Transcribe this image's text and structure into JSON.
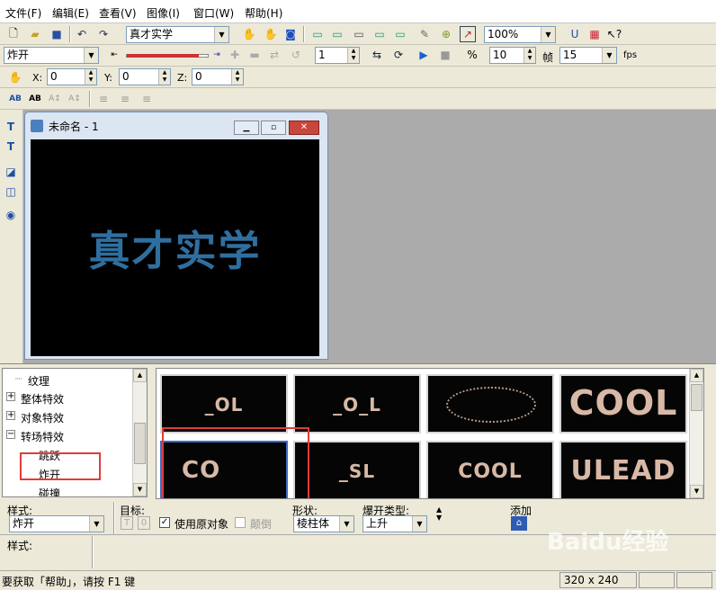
{
  "menu": [
    "文件(F)",
    "编辑(E)",
    "查看(V)",
    "图像(I)",
    "窗口(W)",
    "帮助(H)"
  ],
  "toolbar1": {
    "text_combo": "真才实学",
    "zoom_combo": "100%"
  },
  "toolbar2": {
    "effect_combo": "炸开",
    "frame_value": "1",
    "frames_value": "10",
    "frame_label": "帧",
    "fps_value": "15",
    "fps_label": "fps"
  },
  "toolbar3": {
    "x_label": "X:",
    "x_value": "0",
    "y_label": "Y:",
    "y_value": "0",
    "z_label": "Z:",
    "z_value": "0"
  },
  "document": {
    "title": "未命名 - 1",
    "canvas_text": "真才实学",
    "text_color": "#2f6f9f"
  },
  "tree": [
    "纹理",
    "整体特效",
    "对象特效",
    "转场特效",
    "跳跃",
    "炸开",
    "碰撞"
  ],
  "thumbs": [
    "_OL",
    "_O_L",
    "",
    "COOL",
    "CO",
    "_SL",
    "COOL",
    "ULEAD"
  ],
  "props": {
    "style_label": "样式:",
    "style_value": "炸开",
    "target_label": "目标:",
    "use_original": "使用原对象",
    "flip": "颠倒",
    "shape_label": "形状:",
    "shape_value": "棱柱体",
    "explode_label": "爆开类型:",
    "explode_value": "上升",
    "add_label": "添加",
    "style2_label": "样式:"
  },
  "status": {
    "hint": "要获取「帮助」，请按 F1 键",
    "size": "320 x 240",
    "watermark": "Baidu经验"
  }
}
